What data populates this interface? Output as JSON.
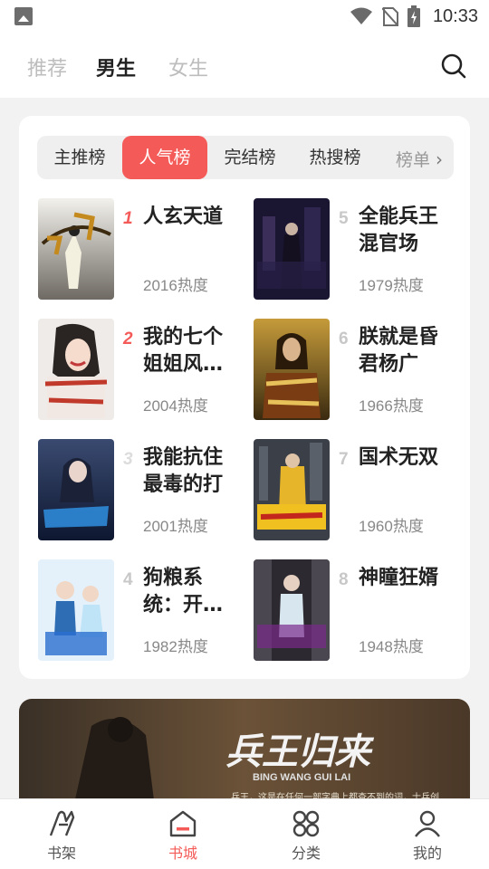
{
  "status": {
    "time": "10:33"
  },
  "nav": {
    "tabs": [
      "推荐",
      "男生",
      "女生"
    ]
  },
  "rank": {
    "tabs": [
      "主推榜",
      "人气榜",
      "完结榜",
      "热搜榜"
    ],
    "more": "榜单",
    "books": [
      {
        "rank": "1",
        "title": "人玄天道",
        "heat": "2016热度"
      },
      {
        "rank": "2",
        "title": "我的七个姐姐风…",
        "heat": "2004热度"
      },
      {
        "rank": "3",
        "title": "我能抗住最毒的打",
        "heat": "2001热度"
      },
      {
        "rank": "4",
        "title": "狗粮系统：开…",
        "heat": "1982热度"
      },
      {
        "rank": "5",
        "title": "全能兵王混官场",
        "heat": "1979热度"
      },
      {
        "rank": "6",
        "title": "朕就是昏君杨广",
        "heat": "1966热度"
      },
      {
        "rank": "7",
        "title": "国术无双",
        "heat": "1960热度"
      },
      {
        "rank": "8",
        "title": "神瞳狂婿",
        "heat": "1948热度"
      }
    ]
  },
  "banner": {
    "title": "兵王归来",
    "subtitle": "BING WANG GUI LAI",
    "text": "兵王，这是在任何一部字典上都查不到的词，士兵创"
  },
  "bottom_nav": {
    "items": [
      "书架",
      "书城",
      "分类",
      "我的"
    ]
  },
  "colors": {
    "accent": "#f45a57"
  }
}
